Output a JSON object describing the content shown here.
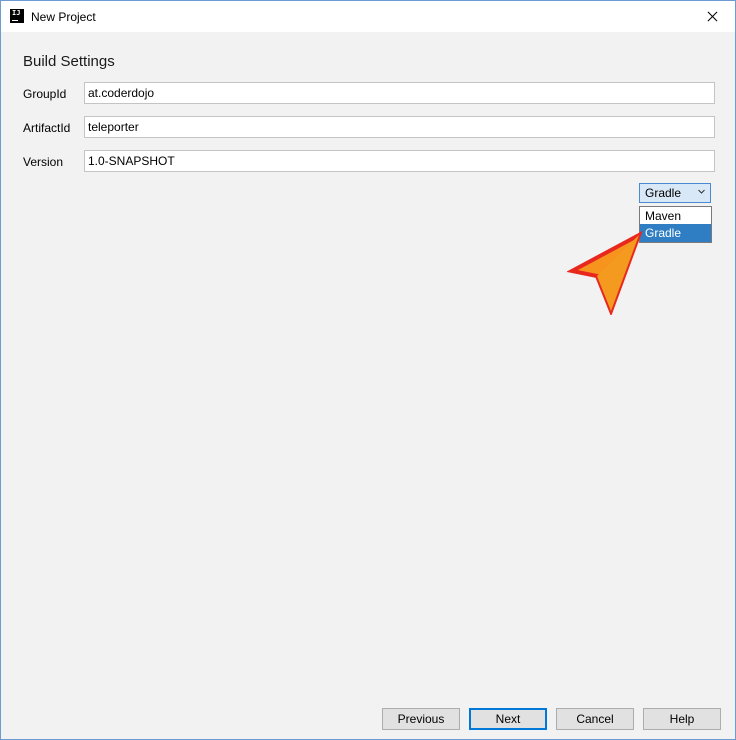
{
  "window": {
    "title": "New Project",
    "icon": "intellij-app-icon",
    "app_icon_text": "IJ"
  },
  "section": {
    "title": "Build Settings"
  },
  "fields": [
    {
      "label": "GroupId",
      "value": "at.coderdojo"
    },
    {
      "label": "ArtifactId",
      "value": "teleporter"
    },
    {
      "label": "Version",
      "value": "1.0-SNAPSHOT"
    }
  ],
  "build_tool": {
    "selected": "Gradle",
    "options": [
      "Maven",
      "Gradle"
    ],
    "highlighted_option": "Gradle"
  },
  "annotation": {
    "icon": "orange-arrow-pointer",
    "fill_color": "#f7941d",
    "stroke_color": "#e8281e"
  },
  "buttons": {
    "previous": "Previous",
    "next": "Next",
    "cancel": "Cancel",
    "help": "Help"
  },
  "colors": {
    "accent": "#0078d7",
    "selection": "#2f7ec3",
    "background": "#f2f2f2"
  }
}
